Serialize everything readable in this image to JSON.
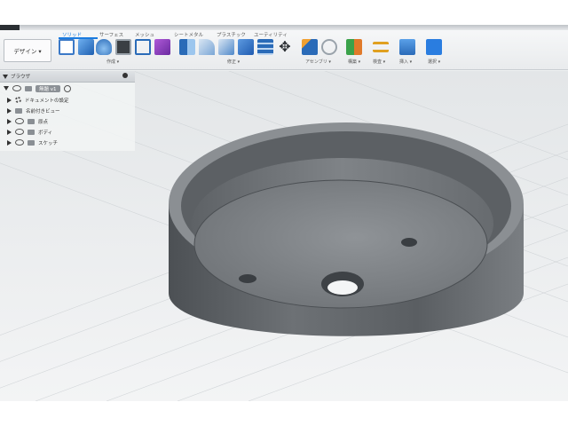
{
  "app": {
    "accent": "#1b7be0",
    "workspace_label": "デザイン ▾"
  },
  "toolbar": {
    "tabs": [
      {
        "label": "ソリッド",
        "active": true
      },
      {
        "label": "サーフェス",
        "active": false
      },
      {
        "label": "メッシュ",
        "active": false
      },
      {
        "label": "シートメタル",
        "active": false
      },
      {
        "label": "プラスチック",
        "active": false
      },
      {
        "label": "ユーティリティ",
        "active": false
      }
    ],
    "groups": {
      "create": "作成 ▾",
      "modify": "修正 ▾",
      "assemble": "アセンブリ ▾",
      "construct": "構築 ▾",
      "inspect": "検査 ▾",
      "insert": "挿入 ▾",
      "select": "選択 ▾"
    }
  },
  "browser": {
    "title": "ブラウザ",
    "root_label": "無題 v1",
    "items": [
      {
        "label": "ドキュメントの設定",
        "icon": "gear-icon"
      },
      {
        "label": "名前付きビュー",
        "icon": "folder-icon"
      },
      {
        "label": "原点",
        "icon": "folder-icon"
      },
      {
        "label": "ボディ",
        "icon": "folder-icon"
      },
      {
        "label": "スケッチ",
        "icon": "folder-icon"
      }
    ]
  }
}
